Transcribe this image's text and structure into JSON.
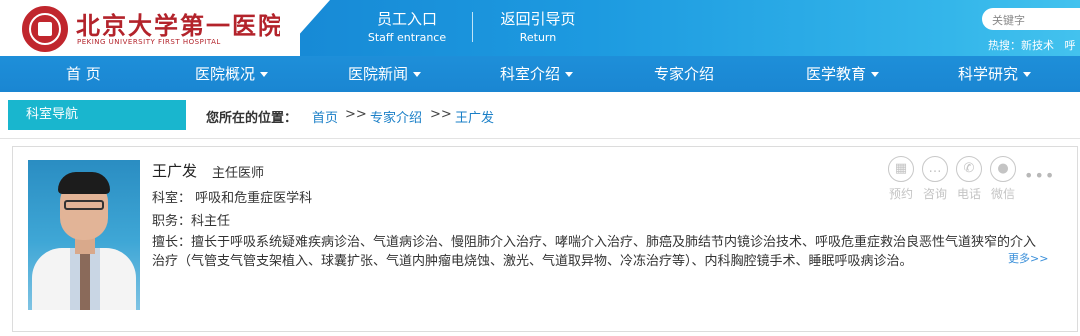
{
  "logo": {
    "name_cn": "北京大学第一医院",
    "name_en": "PEKING UNIVERSITY FIRST HOSPITAL"
  },
  "banner": {
    "staff": {
      "cn": "员工入口",
      "en": "Staff entrance"
    },
    "return": {
      "cn": "返回引导页",
      "en": "Return"
    }
  },
  "search": {
    "placeholder": "关键字",
    "hot_label": "热搜：",
    "hot_items": [
      "新技术",
      "呼"
    ]
  },
  "nav": {
    "items": [
      {
        "label": "首 页",
        "has_dropdown": false
      },
      {
        "label": "医院概况",
        "has_dropdown": true
      },
      {
        "label": "医院新闻",
        "has_dropdown": true
      },
      {
        "label": "科室介绍",
        "has_dropdown": true
      },
      {
        "label": "专家介绍",
        "has_dropdown": false
      },
      {
        "label": "医学教育",
        "has_dropdown": true
      },
      {
        "label": "科学研究",
        "has_dropdown": true
      }
    ]
  },
  "subnav": {
    "label": "科室导航"
  },
  "breadcrumb": {
    "label": "您所在的位置：",
    "items": [
      "首页",
      "专家介绍",
      "王广发"
    ],
    "separator": ">>"
  },
  "doctor": {
    "name": "王广发",
    "title": "主任医师",
    "department_label": "科室：",
    "department": "呼吸和危重症医学科",
    "position_label": "职务：",
    "position": "科主任",
    "specialty_label": "擅长：",
    "specialty": "擅长于呼吸系统疑难疾病诊治、气道病诊治、慢阻肺介入治疗、哮喘介入治疗、肺癌及肺结节内镜诊治技术、呼吸危重症救治良恶性气道狭窄的介入治疗（气管支气管支架植入、球囊扩张、气道内肿瘤电烧蚀、激光、气道取异物、冷冻治疗等）、内科胸腔镜手术、睡眠呼吸病诊治。",
    "more": "更多>>"
  },
  "services": [
    {
      "label": "预约",
      "icon": "calendar-icon"
    },
    {
      "label": "咨询",
      "icon": "chat-icon"
    },
    {
      "label": "电话",
      "icon": "phone-icon"
    },
    {
      "label": "微信",
      "icon": "wechat-icon"
    }
  ],
  "colors": {
    "brand_red": "#b3232b",
    "banner_blue": "#1d9ae0",
    "nav_blue": "#1e8fd9",
    "subnav_teal": "#19b6ce",
    "link_blue": "#1a7fc7"
  }
}
